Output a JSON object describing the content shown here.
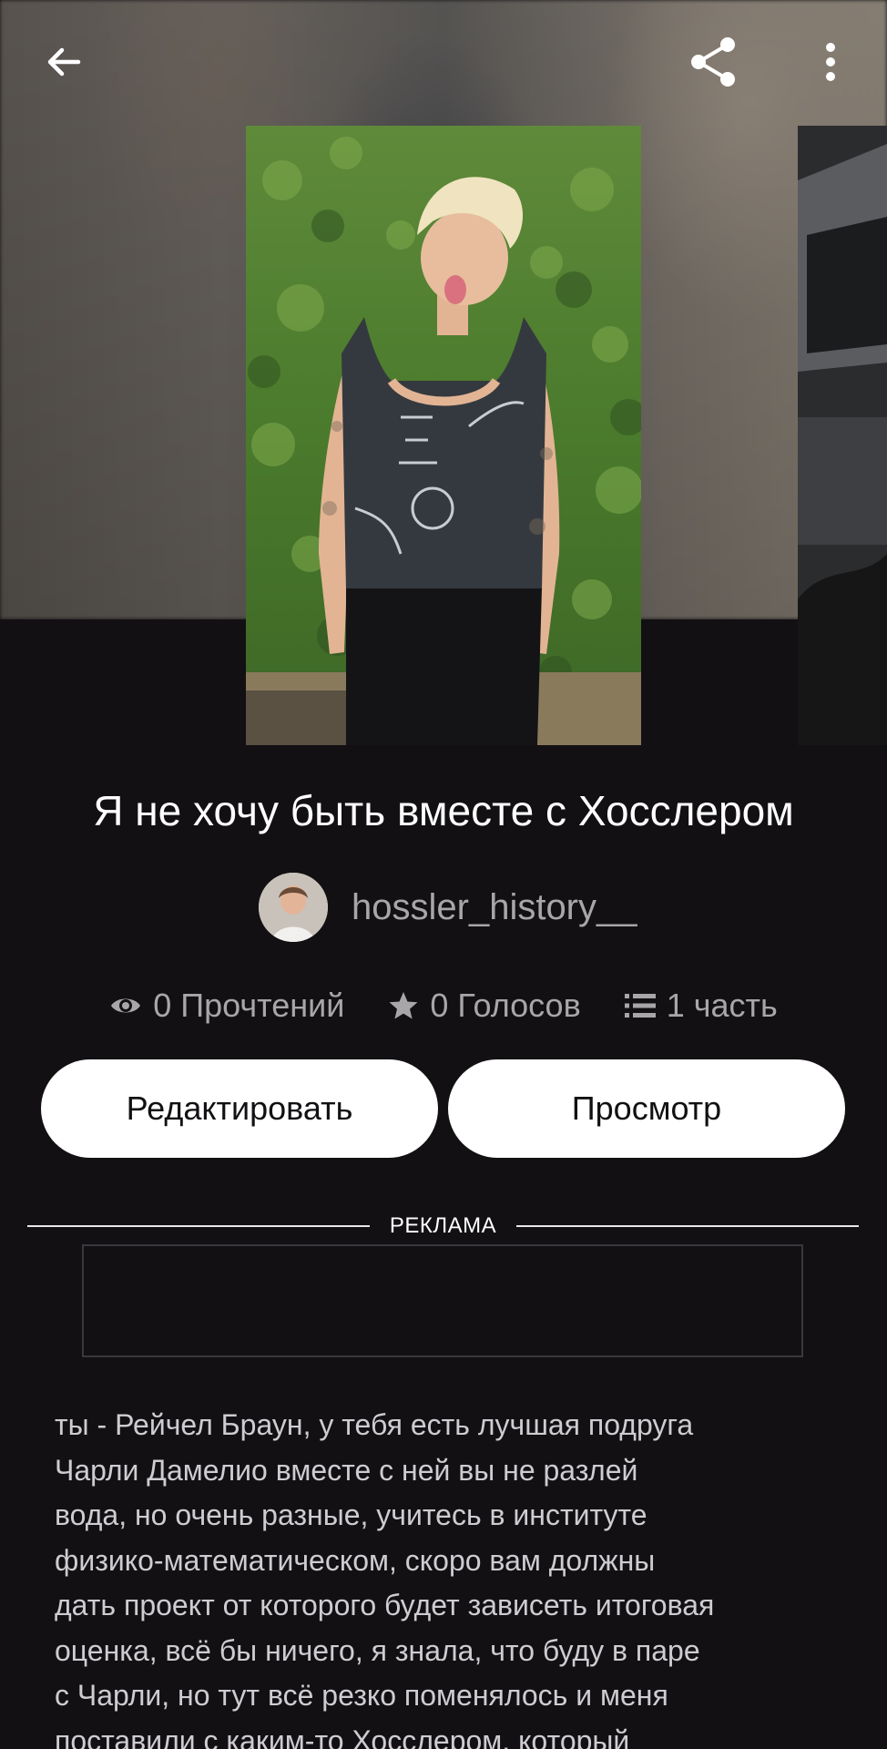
{
  "header": {
    "back_icon": "arrow-left-icon",
    "share_icon": "share-icon",
    "more_icon": "more-vertical-icon"
  },
  "story": {
    "title": "Я не хочу быть вместе с Хосслером",
    "author": "hossler_history__",
    "stats": {
      "reads": "0 Прочтений",
      "votes": "0 Голосов",
      "parts": "1 часть"
    }
  },
  "actions": {
    "edit_label": "Редактировать",
    "view_label": "Просмотр"
  },
  "ad": {
    "label": "РЕКЛАМА"
  },
  "description": "ты - Рейчел Браун, у тебя есть лучшая подруга\nЧарли Дамелио вместе с ней вы не разлей\nвода, но очень разные, учитесь в институте\nфизико-математическом, скоро вам должны\nдать проект от которого будет зависеть итоговая\nоценка, всё бы ничего, я знала, что буду в паре\nс Чарли, но тут всё резко поменялось и меня\nпоставили с каким-то Хосслером, который",
  "colors": {
    "background": "#121013",
    "button_bg": "#ffffff",
    "muted_text": "#a9a6aa"
  }
}
